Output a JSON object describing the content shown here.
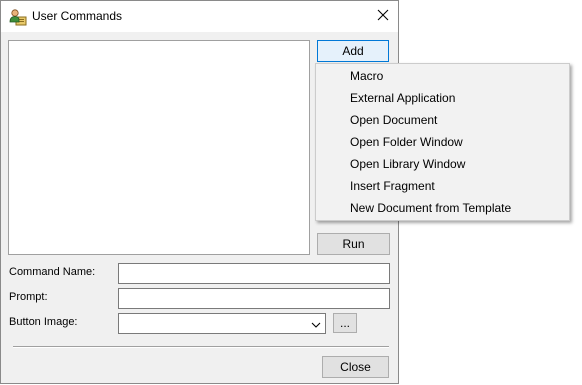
{
  "window": {
    "title": "User Commands",
    "close_glyph": "×"
  },
  "buttons": {
    "add": "Add",
    "run": "Run",
    "browse": "...",
    "close": "Close"
  },
  "fields": {
    "command_name_label": "Command Name:",
    "command_name_value": "",
    "prompt_label": "Prompt:",
    "prompt_value": "",
    "button_image_label": "Button Image:",
    "button_image_value": ""
  },
  "command_list": [],
  "add_menu": {
    "items": [
      "Macro",
      "External Application",
      "Open Document",
      "Open Folder Window",
      "Open Library Window",
      "Insert Fragment",
      "New Document from Template"
    ]
  },
  "icons": {
    "app": "user-commands-icon",
    "close": "close-icon",
    "dropdown": "chevron-down-icon"
  },
  "colors": {
    "focus_border": "#0078d7",
    "dialog_bg": "#f0f0f0",
    "menu_bg": "#f2f2f2"
  }
}
